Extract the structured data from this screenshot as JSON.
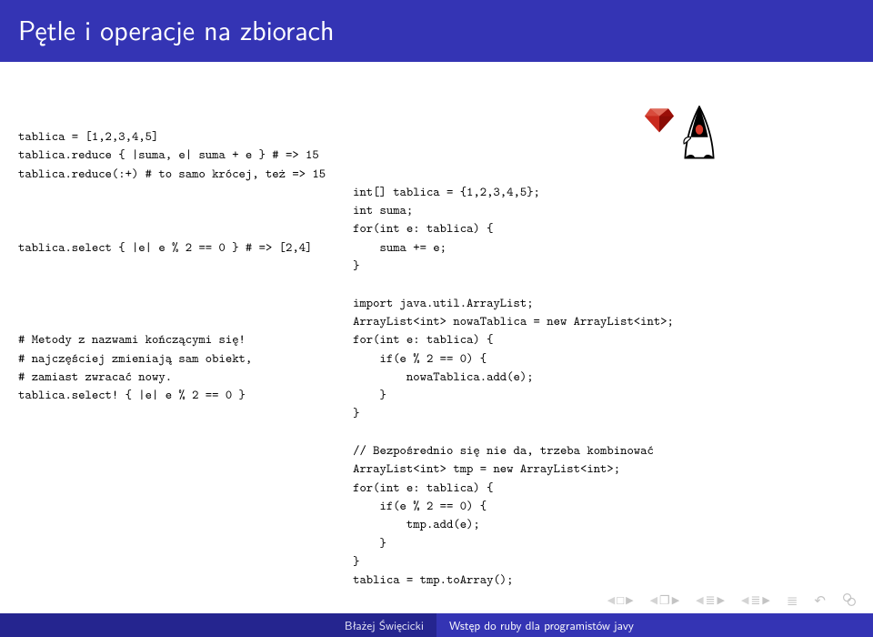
{
  "title": "Pętle i operacje na zbiorach",
  "left_code": "tablica = [1,2,3,4,5]\ntablica.reduce { |suma, e| suma + e } # => 15\ntablica.reduce(:+) # to samo krócej, też => 15\n\n\n\ntablica.select { |e| e % 2 == 0 } # => [2,4]\n\n\n\n\n# Metody z nazwami kończącymi się!\n# najczęściej zmieniają sam obiekt,\n# zamiast zwracać nowy.\ntablica.select! { |e| e % 2 == 0 }",
  "right_code": "int[] tablica = {1,2,3,4,5};\nint suma;\nfor(int e: tablica) {\n    suma += e;\n}\n\nimport java.util.ArrayList;\nArrayList<int> nowaTablica = new ArrayList<int>;\nfor(int e: tablica) {\n    if(e % 2 == 0) {\n        nowaTablica.add(e);\n    }\n}\n\n// Bezpośrednio się nie da, trzeba kombinować\nArrayList<int> tmp = new ArrayList<int>;\nfor(int e: tablica) {\n    if(e % 2 == 0) {\n        tmp.add(e);\n    }\n}\ntablica = tmp.toArray();",
  "footer": {
    "author": "Błażej Święcicki",
    "subtitle": "Wstęp do ruby dla programistów javy"
  }
}
